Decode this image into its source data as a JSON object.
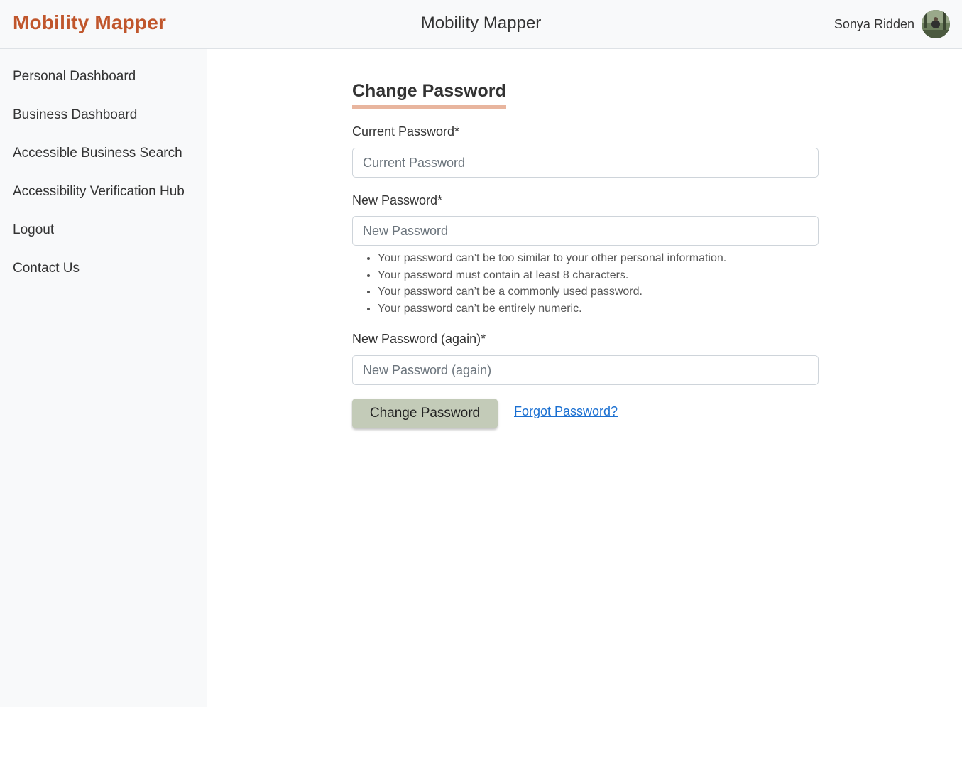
{
  "header": {
    "brand": "Mobility Mapper",
    "title": "Mobility Mapper",
    "user_name": "Sonya Ridden",
    "accent_color": "#c0562c"
  },
  "sidebar": {
    "items": [
      {
        "label": "Personal Dashboard"
      },
      {
        "label": "Business Dashboard"
      },
      {
        "label": "Accessible Business Search"
      },
      {
        "label": "Accessibility Verification Hub"
      },
      {
        "label": "Logout"
      },
      {
        "label": "Contact Us"
      }
    ]
  },
  "form": {
    "heading": "Change Password",
    "current": {
      "label": "Current Password*",
      "placeholder": "Current Password",
      "value": ""
    },
    "new": {
      "label": "New Password*",
      "placeholder": "New Password",
      "value": ""
    },
    "rules": [
      "Your password can’t be too similar to your other personal information.",
      "Your password must contain at least 8 characters.",
      "Your password can’t be a commonly used password.",
      "Your password can’t be entirely numeric."
    ],
    "confirm": {
      "label": "New Password (again)*",
      "placeholder": "New Password (again)",
      "value": ""
    },
    "submit_label": "Change Password",
    "forgot_label": "Forgot Password?"
  }
}
